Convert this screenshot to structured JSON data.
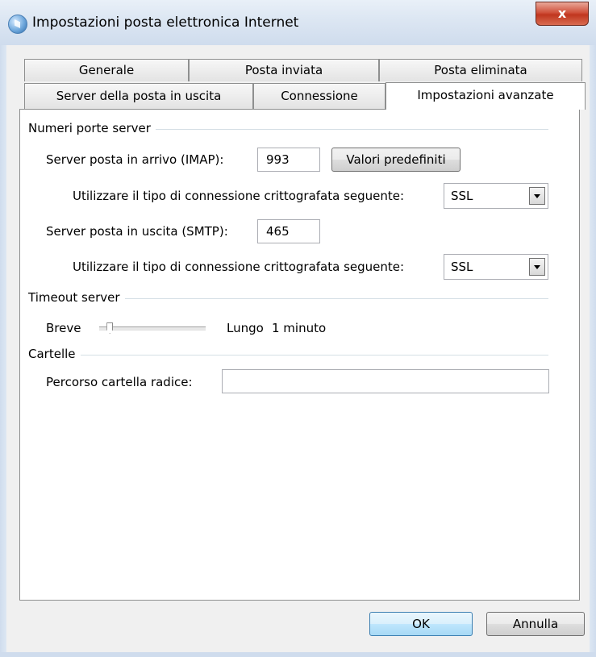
{
  "window": {
    "title": "Impostazioni posta elettronica Internet",
    "close_label": "x"
  },
  "tabs": {
    "row1": [
      "Generale",
      "Posta inviata",
      "Posta eliminata"
    ],
    "row2": [
      "Server della posta in uscita",
      "Connessione",
      "Impostazioni avanzate"
    ],
    "active": "Impostazioni avanzate"
  },
  "server_ports": {
    "group_label": "Numeri porte server",
    "incoming_label": "Server posta in arrivo (IMAP):",
    "incoming_port": "993",
    "defaults_button": "Valori predefiniti",
    "incoming_encryption_label": "Utilizzare il tipo di connessione crittografata seguente:",
    "incoming_encryption": "SSL",
    "outgoing_label": "Server posta in uscita (SMTP):",
    "outgoing_port": "465",
    "outgoing_encryption_label": "Utilizzare il tipo di connessione crittografata seguente:",
    "outgoing_encryption": "SSL"
  },
  "timeout": {
    "group_label": "Timeout server",
    "short_label": "Breve",
    "long_label": "Lungo",
    "value_label": "1 minuto",
    "slider_level": 0.1
  },
  "folders": {
    "group_label": "Cartelle",
    "root_path_label": "Percorso cartella radice:",
    "root_path_value": ""
  },
  "buttons": {
    "ok": "OK",
    "cancel": "Annulla"
  }
}
